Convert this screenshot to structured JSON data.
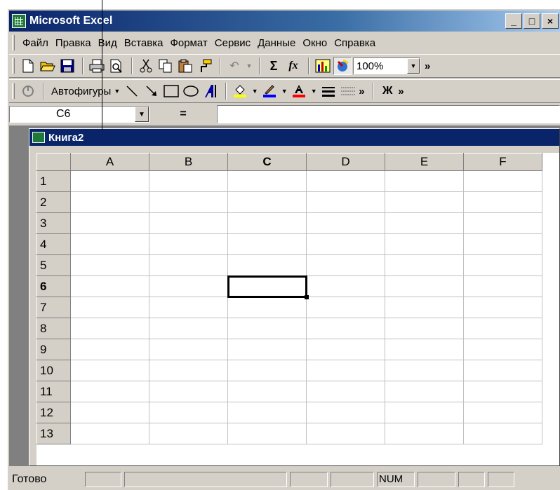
{
  "window": {
    "title": "Microsoft Excel",
    "min_label": "_",
    "max_label": "□",
    "close_label": "×"
  },
  "menu": {
    "items": [
      "Файл",
      "Правка",
      "Вид",
      "Вставка",
      "Формат",
      "Сервис",
      "Данные",
      "Окно",
      "Справка"
    ]
  },
  "toolbar": {
    "sum_label": "Σ",
    "fx_label": "fx",
    "zoom_value": "100%",
    "more_label": "»"
  },
  "drawing": {
    "autoshapes_label": "Автофигуры",
    "bold_label": "Ж"
  },
  "formula": {
    "cell_ref": "C6",
    "eq_label": "="
  },
  "workbook": {
    "title": "Книга2",
    "columns": [
      "A",
      "B",
      "C",
      "D",
      "E",
      "F"
    ],
    "rows": [
      "1",
      "2",
      "3",
      "4",
      "5",
      "6",
      "7",
      "8",
      "9",
      "10",
      "11",
      "12",
      "13"
    ],
    "selected_column": "C",
    "selected_row": "6"
  },
  "status": {
    "text": "Готово",
    "num_indicator": "NUM"
  },
  "colors": {
    "title_bar": "#0a246a",
    "face": "#d4d0c8",
    "workspace": "#808080"
  }
}
